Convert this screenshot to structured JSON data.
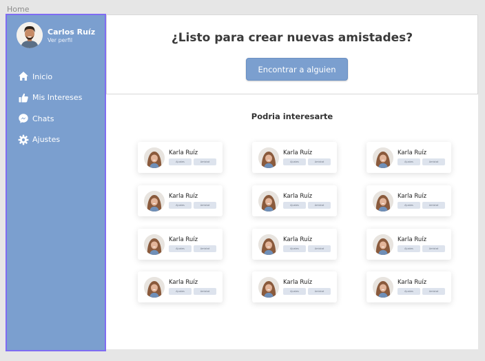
{
  "frame": {
    "label": "Home"
  },
  "sidebar": {
    "profile": {
      "name": "Carlos Ruíz",
      "link": "Ver perfil"
    },
    "items": [
      {
        "label": "Inicio",
        "icon": "home-icon"
      },
      {
        "label": "Mis Intereses",
        "icon": "thumbs-up-icon"
      },
      {
        "label": "Chats",
        "icon": "messenger-icon"
      },
      {
        "label": "Ajustes",
        "icon": "gear-icon"
      }
    ]
  },
  "hero": {
    "title": "¿Listo para crear nuevas amistades?",
    "button": "Encontrar a alguien"
  },
  "suggestions": {
    "title": "Podria interesarte",
    "card_name": "Karla Ruíz",
    "chip_a": "Ajustes",
    "chip_b": "Amistat",
    "count": 12
  },
  "colors": {
    "sidebar": "#7b9fcf",
    "accent": "#7b9fcf",
    "selection_border": "#7f6cf2",
    "background": "#e6e6e6"
  }
}
